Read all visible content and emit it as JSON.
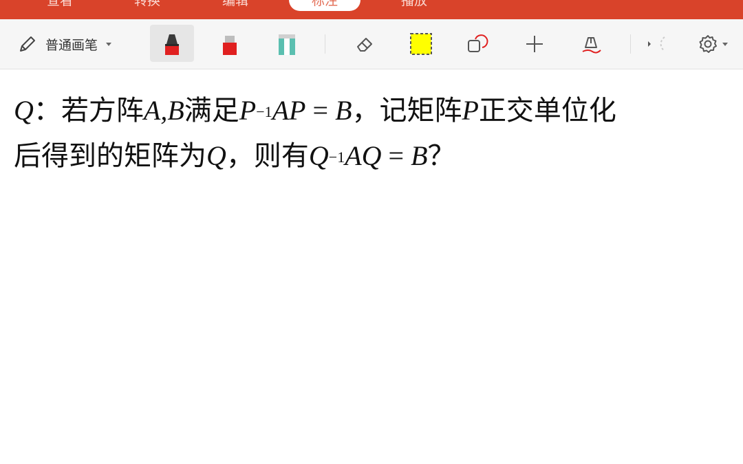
{
  "tabs": [
    {
      "label": "查看",
      "active": false
    },
    {
      "label": "转换",
      "active": false
    },
    {
      "label": "编辑",
      "active": false
    },
    {
      "label": "标注",
      "active": true
    },
    {
      "label": "播放",
      "active": false
    }
  ],
  "toolbar": {
    "pen_mode_label": "普通画笔",
    "icons": [
      "pencil-icon",
      "dropdown-caret-icon",
      "marker-red-icon",
      "highlighter-red-icon",
      "highlighter-teal-icon",
      "eraser-icon",
      "yellow-selection-icon",
      "shape-icon",
      "plus-icon",
      "signature-pen-icon",
      "more-icon",
      "settings-icon"
    ],
    "colors": {
      "accent": "#d9432a",
      "marker": "#e02020",
      "teal": "#5bbfb0",
      "yellow": "#ffff00"
    }
  },
  "content": {
    "line1": {
      "q": "Q",
      "colon": "：",
      "t1": "若方阵",
      "A1": "A",
      "comma": ",",
      "B1": "B",
      "t2": "满足",
      "P1": "P",
      "sup1": "−1",
      "AP": "AP",
      "eq1": " = ",
      "B2": "B",
      "t3": "，记矩阵",
      "P2": "P",
      "t4": "正交单位化"
    },
    "line2": {
      "t1": "后得到的矩阵为",
      "Q1": "Q",
      "t2": "，则有",
      "Q2": "Q",
      "sup2": "−1",
      "AQ": "AQ",
      "eq2": " = ",
      "B3": "B",
      "qm": "？"
    }
  }
}
